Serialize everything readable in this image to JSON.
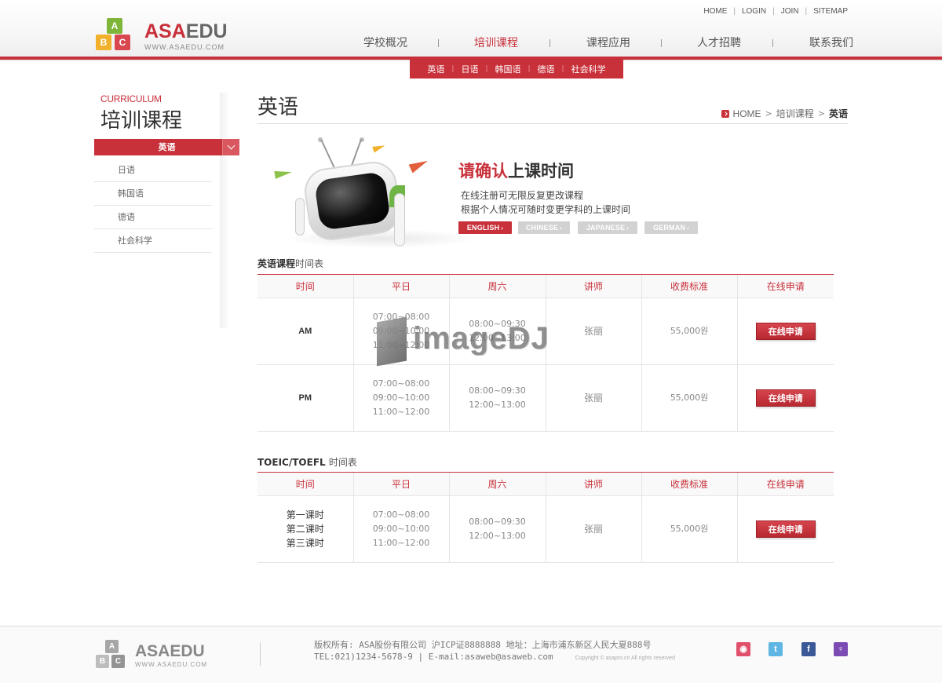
{
  "header": {
    "logo": {
      "name_accent": "ASA",
      "name_rest": "EDU",
      "url": "WWW.ASAEDU.COM",
      "blocks": [
        "A",
        "B",
        "C"
      ]
    },
    "util_nav": [
      "HOME",
      "LOGIN",
      "JOIN",
      "SITEMAP"
    ],
    "gnb": [
      "学校概况",
      "培训课程",
      "课程应用",
      "人才招聘",
      "联系我们"
    ],
    "gnb_active": "培训课程",
    "subnav": [
      "英语",
      "日语",
      "韩国语",
      "德语",
      "社会科学"
    ]
  },
  "sidebar": {
    "en_title": "CURRICULUM",
    "title": "培训课程",
    "active_item": "英语",
    "items": [
      "日语",
      "韩国语",
      "德语",
      "社会科学"
    ]
  },
  "content": {
    "page_title": "英语",
    "breadcrumb": {
      "home": "HOME",
      "parent": "培训课程",
      "current": "英语"
    },
    "promo": {
      "headline_red": "请确认",
      "headline_rest": "上课时间",
      "line1": "在线注册可无限反复更改课程",
      "line2": "根据个人情况可随时变更学科的上课时间",
      "lang_buttons": [
        "ENGLISH",
        "CHINESE",
        "JAPANESE",
        "GERMAN"
      ],
      "lang_active": "ENGLISH"
    },
    "table1": {
      "title_bold": "英语课程",
      "title_light": "时间表",
      "headers": [
        "时间",
        "平日",
        "周六",
        "讲师",
        "收费标准",
        "在线申请"
      ],
      "rows": [
        {
          "label": "AM",
          "weekday": [
            "07:00~08:00",
            "09:00~10:00",
            "11:00~12:00"
          ],
          "saturday": [
            "08:00~09:30",
            "12:00~13:00"
          ],
          "teacher": "张丽",
          "fee": "55,000원",
          "apply": "在线申请"
        },
        {
          "label": "PM",
          "weekday": [
            "07:00~08:00",
            "09:00~10:00",
            "11:00~12:00"
          ],
          "saturday": [
            "08:00~09:30",
            "12:00~13:00"
          ],
          "teacher": "张丽",
          "fee": "55,000원",
          "apply": "在线申请"
        }
      ]
    },
    "table2": {
      "title_bold": "TOEIC/TOEFL",
      "title_light": "时间表",
      "headers": [
        "时间",
        "平日",
        "周六",
        "讲师",
        "收费标准",
        "在线申请"
      ],
      "rows": [
        {
          "label": [
            "第一课时",
            "第二课时",
            "第三课时"
          ],
          "weekday": [
            "07:00~08:00",
            "09:00~10:00",
            "11:00~12:00"
          ],
          "saturday": [
            "08:00~09:30",
            "12:00~13:00"
          ],
          "teacher": "张丽",
          "fee": "55,000원",
          "apply": "在线申请"
        }
      ]
    },
    "watermark": "imageDJ"
  },
  "footer": {
    "logo": {
      "name": "ASAEDU",
      "url": "WWW.ASAEDU.COM",
      "blocks": [
        "A",
        "B",
        "C"
      ]
    },
    "line1": "版权所有: ASA股份有限公司 沪ICP证8888888 地址：上海市浦东新区人民大夏888号",
    "line2": "TEL:021)1234-5678-9 | E-mail:asaweb@asaweb.com",
    "copyright": "Copyright © asapro.cn All rights reserved",
    "social": [
      {
        "name": "weibo",
        "glyph": "◉"
      },
      {
        "name": "twitter",
        "glyph": "t"
      },
      {
        "name": "facebook",
        "glyph": "f"
      },
      {
        "name": "other",
        "glyph": "♀"
      }
    ]
  }
}
